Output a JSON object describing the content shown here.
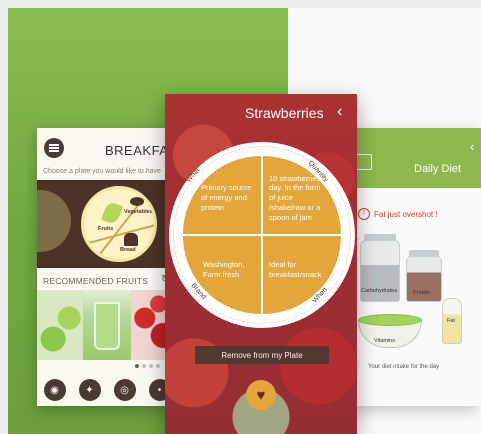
{
  "left_screen": {
    "title": "BREAKFAS",
    "subtitle": "Choose a plate you would like to have",
    "plate_labels": {
      "fruits": "Fruits",
      "vegetables": "Vegetables",
      "bread": "Bread"
    },
    "recommended_label": "RECOMMENDED FRUITS",
    "nav_icons": [
      "plate-icon",
      "run-icon",
      "eye-icon",
      "more-icon"
    ]
  },
  "center_screen": {
    "title": "Strawberries",
    "quadrants": {
      "what": "Primary source of energy and protein",
      "quantity": "10 strawberries a day. In the form of juice /shake/raw or a spoon of jam",
      "brand": "Washington, Farm fresh",
      "when": "Ideal for breakfast/snack"
    },
    "rim_labels": {
      "what": "What",
      "quantity": "Quantity",
      "brand": "Brand",
      "when": "When"
    },
    "remove_button": "Remove from my Plate"
  },
  "right_screen": {
    "title": "Daily Diet",
    "alert": "Fat just overshot !",
    "jar_labels": {
      "carbs": "Carbohydrates",
      "protein": "Protein",
      "fat": "Fat",
      "vitamins": "Vitamins"
    },
    "footer": "Your diet intake for the day"
  },
  "colors": {
    "accent": "#e2a63a",
    "green": "#8cb84e",
    "brown": "#4a3a32",
    "alert": "#d23b2f"
  }
}
